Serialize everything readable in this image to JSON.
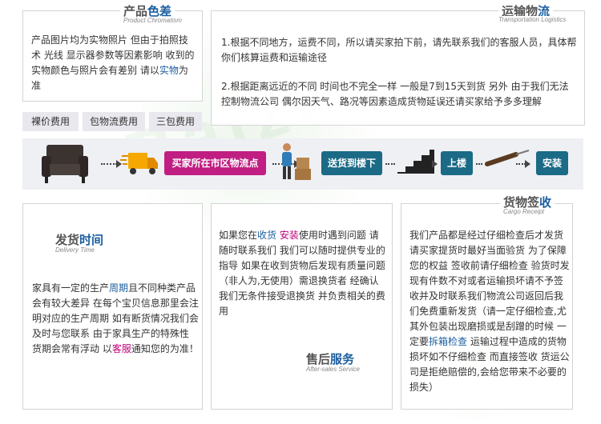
{
  "watermark": "Baizesu",
  "product_color": {
    "title_main": "产品",
    "title_accent": "色差",
    "subtitle": "Product Chromatism",
    "text_parts": [
      "产品图片均为实物照片 但由于拍照技术 光线 显示器参数等因素影响 收到的实物颜色与照片会有差别 请以",
      "实物",
      "为准"
    ]
  },
  "transport": {
    "title_main": "运输物",
    "title_accent": "流",
    "subtitle": "Transportation Logistics",
    "p1": "1.根据不同地方，运费不同，所以请买家拍下前，请先联系我们的客服人员，具体帮你们核算运费和运输途径",
    "p2": "2.根据距离远近的不同 时间也不完全一样 一般是7到15天到货 另外 由于我们无法控制物流公司 偶尔因天气、路况等因素造成货物延误还请买家给予多多理解"
  },
  "tabs": [
    "裸价费用",
    "包物流费用",
    "三包费用"
  ],
  "flow": {
    "steps": [
      "买家所在市区物流点",
      "送货到楼下",
      "上楼",
      "安装"
    ],
    "icons": [
      "sofa-icon",
      "delivery-truck-icon",
      "courier-icon",
      "stairs-icon",
      "screwdriver-icon"
    ]
  },
  "delivery_time": {
    "title_main": "发货",
    "title_accent": "时间",
    "subtitle": "Delivery Time",
    "text_parts": [
      "家具有一定的生产",
      "周期",
      "且不同种类产品会有较大差异 在每个宝贝信息那里会注明对应的生产周期 如有断货情况我们会及时与您联系 由于家具生产的特殊性 货期会常有浮动 以",
      "客服",
      "通知您的为准！"
    ]
  },
  "after_sales": {
    "title_main": "售后",
    "title_accent": "服务",
    "subtitle": "After-sales Service",
    "text_parts": [
      "如果您在",
      "收货",
      " ",
      "安装",
      "使用时遇到问题 请随时联系我们 我们可以随时提供专业的指导 如果在收到货物后发现有质量问题（非人为,无使用）需退换货者 经确认我们无条件接受退换货 并负责相关的费用"
    ]
  },
  "cargo_receipt": {
    "title_main": "货物签",
    "title_accent": "收",
    "subtitle": "Cargo Receipt",
    "text_parts": [
      "我们产品都是经过仔细检查后才发货 请买家提货时最好当面验货 为了保障您的权益 签收前请仔细检查 验货时发现有件数不对或者运输损坏请不予签收并及时联系我们物流公司返回后我们免费重新发货（请一定仔细检查,尤其外包装出现磨损或是刮蹭的时候 一定要",
      "拆箱检查",
      " 运输过程中造成的货物损坏如不仔细检查 而直接签收 货运公司是拒绝赔偿的,会给您带来不必要的损失）"
    ]
  }
}
